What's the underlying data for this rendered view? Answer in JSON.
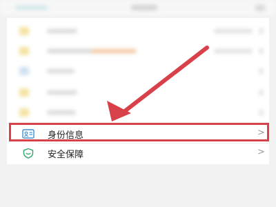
{
  "settings_list": {
    "identity": {
      "label": "身份信息",
      "chevron": ">"
    },
    "security": {
      "label": "安全保障",
      "chevron": ">"
    }
  },
  "annotation": {
    "color": "#d8404a"
  },
  "icons": {
    "identity": "id-card-icon",
    "security": "shield-icon",
    "chevron": "chevron-right-icon"
  }
}
